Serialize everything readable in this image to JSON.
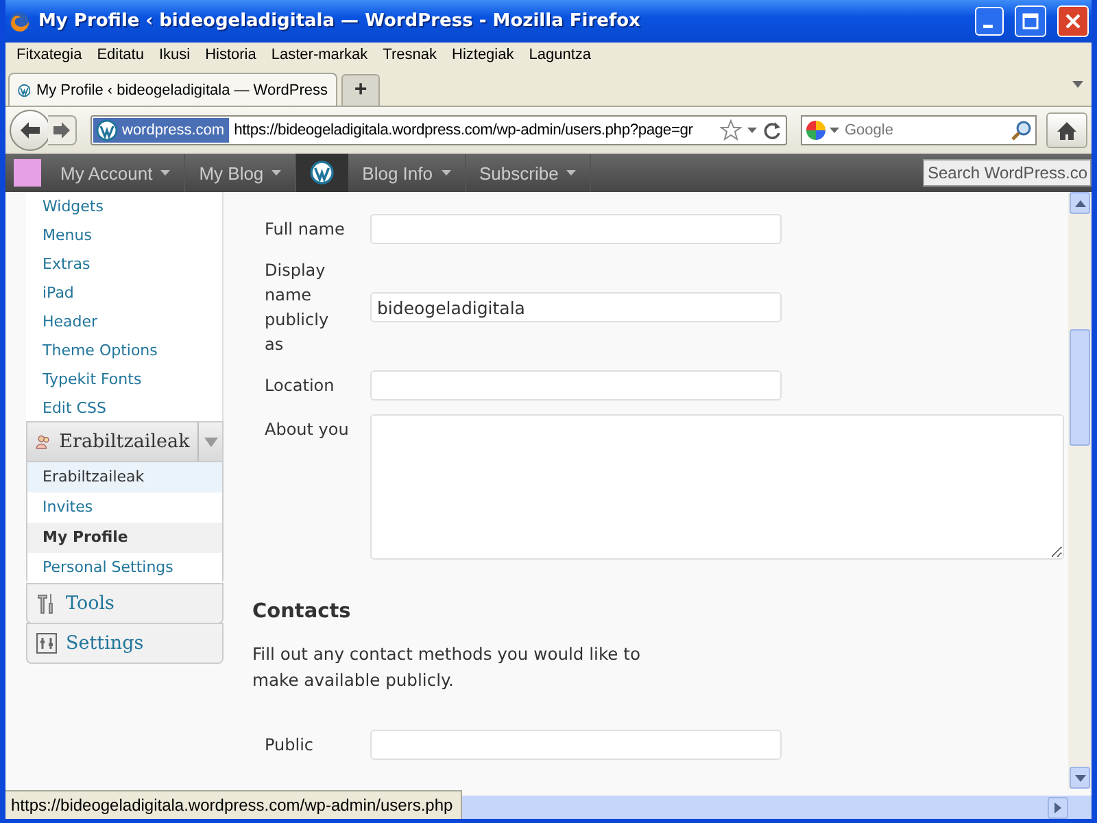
{
  "window": {
    "title": "My Profile ‹ bideogeladigitala — WordPress - Mozilla Firefox"
  },
  "menu": [
    "Fitxategia",
    "Editatu",
    "Ikusi",
    "Historia",
    "Laster-markak",
    "Tresnak",
    "Hiztegiak",
    "Laguntza"
  ],
  "tabs": [
    {
      "label": "My Profile ‹ bideogeladigitala — WordPress",
      "selected": true
    }
  ],
  "new_tab": "+",
  "address": {
    "site_badge": "wordpress.com",
    "url": "https://bideogeladigitala.wordpress.com/wp-admin/users.php?page=gr"
  },
  "search": {
    "placeholder": "Google"
  },
  "admin_bar": {
    "items": [
      {
        "label": "My Account",
        "kind": "avatar"
      },
      {
        "label": "My Blog",
        "kind": "plain"
      },
      {
        "label": "Blog Info",
        "kind": "logo"
      },
      {
        "label": "Subscribe",
        "kind": "plain"
      }
    ],
    "search_placeholder": "Search WordPress.co"
  },
  "sidebar": {
    "items": [
      "Widgets",
      "Menus",
      "Extras",
      "iPad",
      "Header",
      "Theme Options",
      "Typekit Fonts",
      "Edit CSS"
    ],
    "sections": [
      {
        "label": "Erabiltzaileak",
        "kind": "users",
        "expanded": true,
        "children": [
          {
            "label": "Erabiltzaileak",
            "selected": false,
            "hovered": true
          },
          {
            "label": "Invites",
            "selected": false,
            "hovered": false
          },
          {
            "label": "My Profile",
            "selected": true,
            "hovered": false
          },
          {
            "label": "Personal Settings",
            "selected": false,
            "hovered": false
          }
        ]
      },
      {
        "label": "Tools",
        "kind": "tools",
        "expanded": false
      },
      {
        "label": "Settings",
        "kind": "settings",
        "expanded": false
      }
    ]
  },
  "form": {
    "fields": [
      {
        "label": "Full name",
        "kind": "text"
      },
      {
        "label": "Display name publicly as",
        "kind": "text",
        "value": "bideogeladigitala"
      },
      {
        "label": "Location",
        "kind": "text"
      },
      {
        "label": "About you",
        "kind": "textarea"
      }
    ]
  },
  "contacts": {
    "heading": "Contacts",
    "description": "Fill out any contact methods you would like to make available publicly.",
    "fields": [
      {
        "label": "Public",
        "kind": "text"
      }
    ]
  },
  "status_bar": {
    "text": "https://bideogeladigitala.wordpress.com/wp-admin/users.php"
  }
}
